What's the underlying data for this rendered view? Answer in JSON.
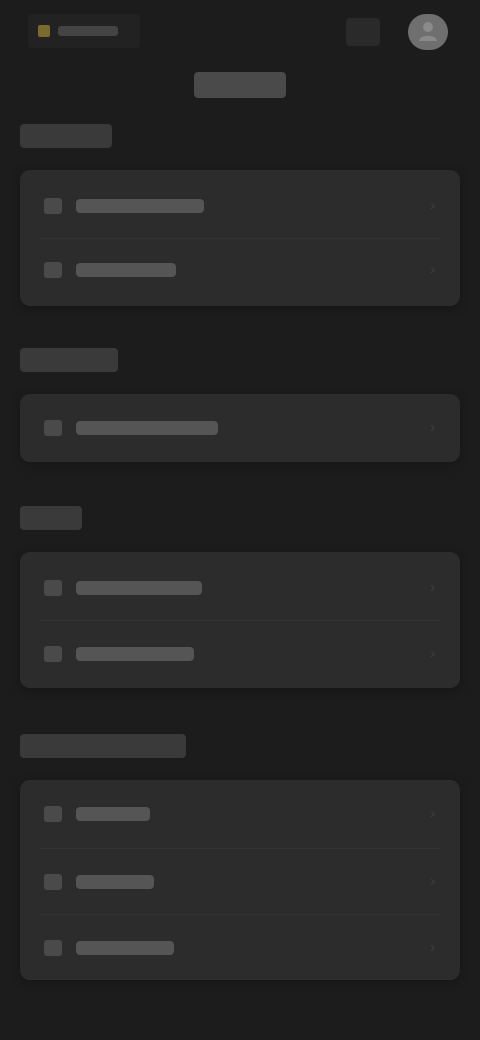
{
  "app": {
    "logo_text": "",
    "title": ""
  },
  "sections": [
    {
      "title": "",
      "items": [
        {
          "label": "",
          "icon": "account-icon"
        },
        {
          "label": "",
          "icon": "security-icon"
        }
      ]
    },
    {
      "title": "",
      "items": [
        {
          "label": "",
          "icon": "preferences-icon"
        }
      ]
    },
    {
      "title": "",
      "items": [
        {
          "label": "",
          "icon": "help-icon"
        },
        {
          "label": "",
          "icon": "feedback-icon"
        }
      ]
    },
    {
      "title": "",
      "items": [
        {
          "label": "",
          "icon": "about-icon"
        },
        {
          "label": "",
          "icon": "terms-icon"
        },
        {
          "label": "",
          "icon": "privacy-icon"
        }
      ]
    }
  ],
  "colors": {
    "background": "#1c1c1c",
    "card": "#2c2c2c",
    "accent": "#7a6a2e",
    "avatar": "#6f6f6f"
  }
}
